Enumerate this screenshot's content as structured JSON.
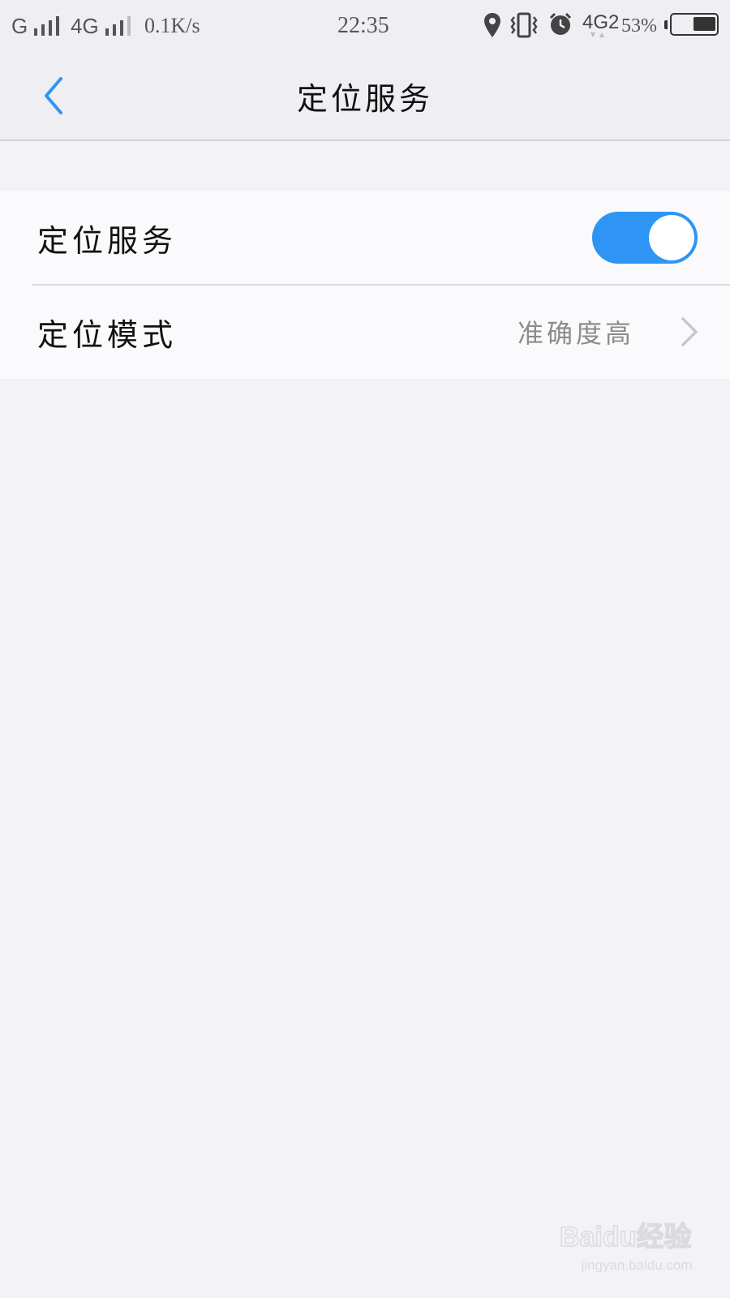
{
  "status_bar": {
    "carrier1": "G",
    "carrier2": "4G",
    "net_speed": "0.1K/s",
    "time": "22:35",
    "network_type": "4G2",
    "battery_percent": "53%",
    "battery_level": 0.53,
    "icons": [
      "location-icon",
      "vibrate-icon",
      "alarm-icon",
      "battery-icon"
    ]
  },
  "nav": {
    "title": "定位服务",
    "back_icon": "chevron-left-icon"
  },
  "settings": {
    "rows": [
      {
        "label": "定位服务",
        "control": "toggle",
        "on": true
      },
      {
        "label": "定位模式",
        "value": "准确度高",
        "icon": "chevron-right-icon"
      }
    ]
  },
  "colors": {
    "accent": "#2e95f4",
    "background": "#f3f2f6",
    "card": "#faf9fb"
  },
  "watermark": {
    "logo": "Baidu经验",
    "url": "jingyan.baidu.com"
  }
}
